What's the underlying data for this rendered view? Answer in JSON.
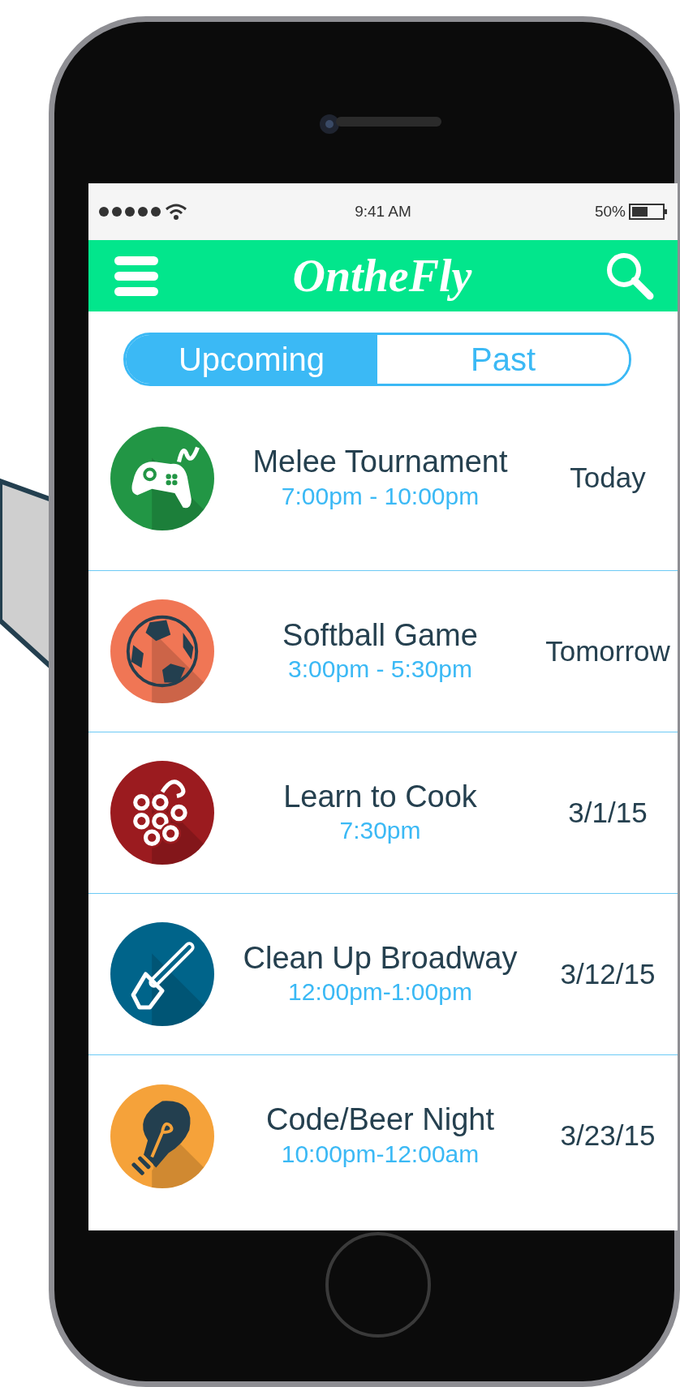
{
  "status_bar": {
    "time": "9:41 AM",
    "battery": "50%"
  },
  "header": {
    "title": "OntheFly"
  },
  "tabs": [
    {
      "label": "Upcoming",
      "selected": true
    },
    {
      "label": "Past",
      "selected": false
    }
  ],
  "events": [
    {
      "kind": "game",
      "color": "#229645",
      "title": "Melee Tournament",
      "time": "7:00pm - 10:00pm",
      "date": "Today"
    },
    {
      "kind": "ball",
      "color": "#f07655",
      "title": "Softball Game",
      "time": "3:00pm - 5:30pm",
      "date": "Tomorrow"
    },
    {
      "kind": "grapes",
      "color": "#9b1b1f",
      "title": "Learn to Cook",
      "time": "7:30pm",
      "date": "3/1/15"
    },
    {
      "kind": "shovel",
      "color": "#00648a",
      "title": "Clean Up Broadway",
      "time": "12:00pm-1:00pm",
      "date": "3/12/15"
    },
    {
      "kind": "bulb",
      "color": "#f5a23a",
      "title": "Code/Beer Night",
      "time": "10:00pm-12:00am",
      "date": "3/23/15"
    }
  ]
}
